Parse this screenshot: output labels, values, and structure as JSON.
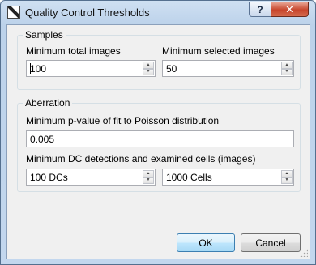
{
  "window": {
    "title": "Quality Control Thresholds",
    "help_label": "?",
    "close_label": "✕"
  },
  "samples": {
    "group_title": "Samples",
    "min_total_label": "Minimum total images",
    "min_total_value": "100",
    "min_selected_label": "Minimum selected images",
    "min_selected_value": "50"
  },
  "aberration": {
    "group_title": "Aberration",
    "pvalue_label": "Minimum p-value of fit to Poisson distribution",
    "pvalue_value": "0.005",
    "dc_label": "Minimum DC detections and examined cells (images)",
    "dc_value": "100 DCs",
    "cells_value": "1000 Cells"
  },
  "buttons": {
    "ok_label": "OK",
    "cancel_label": "Cancel"
  },
  "colors": {
    "titlebar": "#bcd2ea",
    "close_button": "#c7452b",
    "client_background": "#f0f0f0"
  }
}
